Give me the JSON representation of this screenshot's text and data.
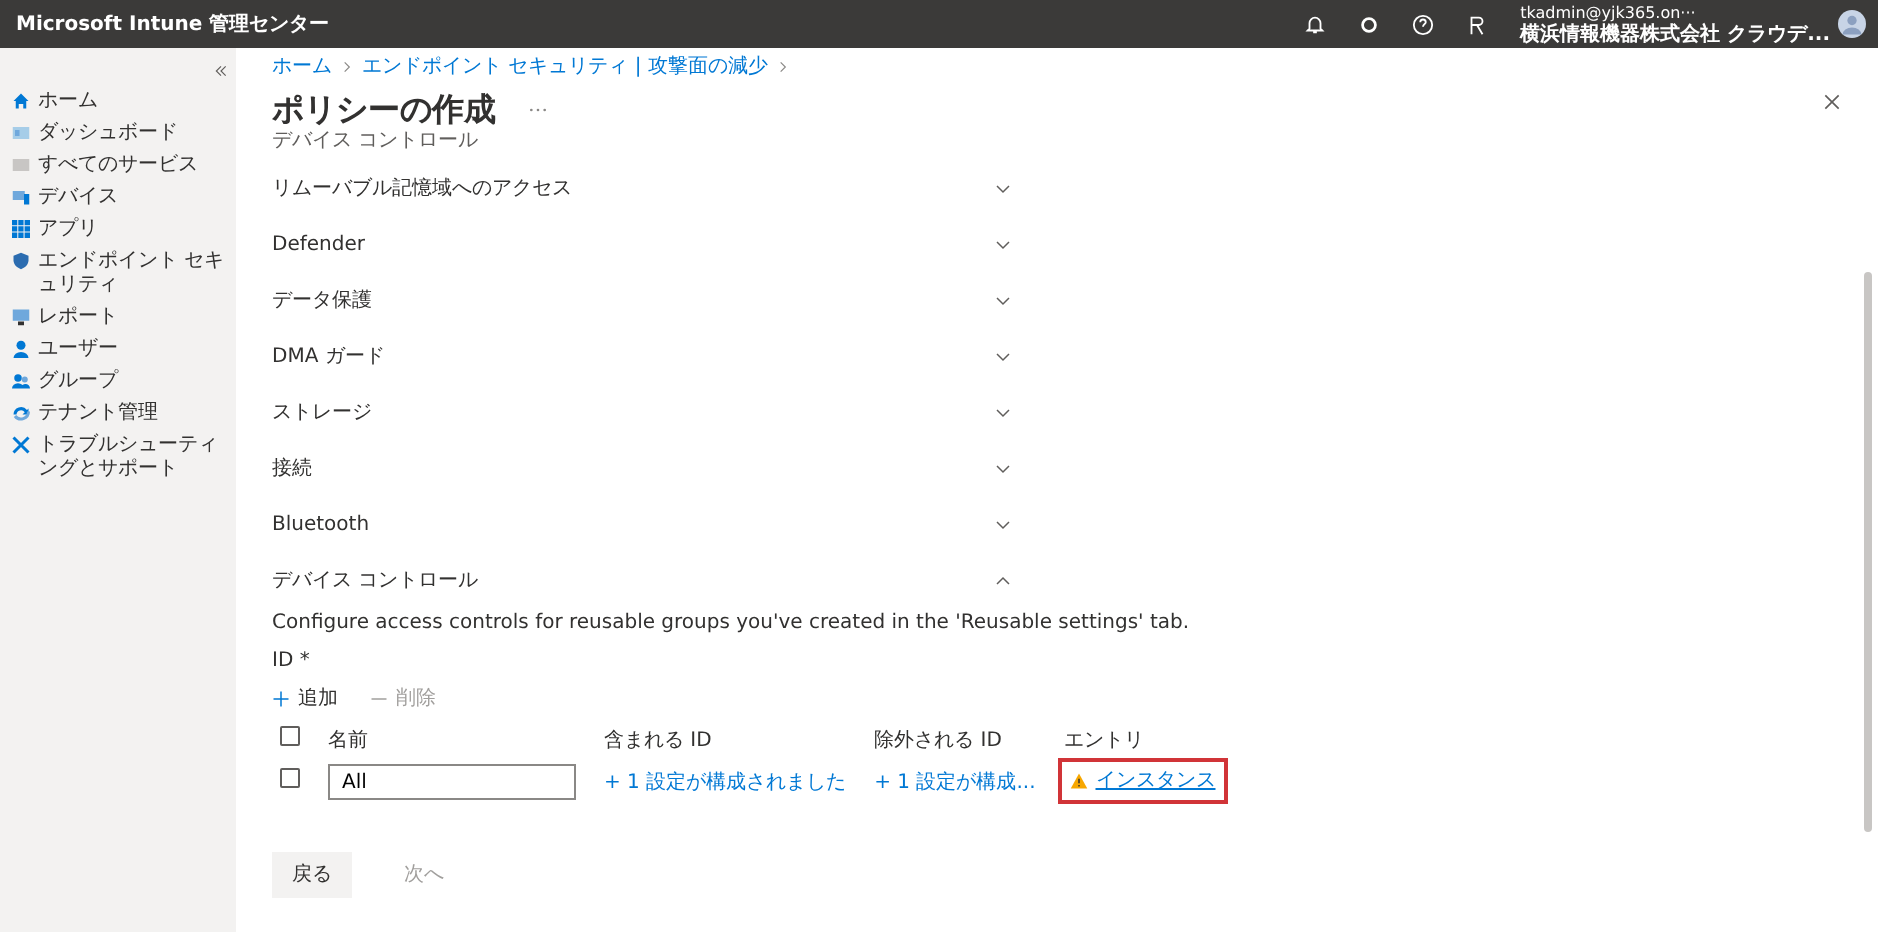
{
  "top_bar": {
    "title": "Microsoft Intune 管理センター",
    "user_email": "tkadmin@yjk365.on···",
    "user_org": "横浜情報機器株式会社 クラウデ..."
  },
  "sidebar": {
    "items": [
      {
        "label": "ホーム"
      },
      {
        "label": "ダッシュボード"
      },
      {
        "label": "すべてのサービス"
      },
      {
        "label": "デバイス"
      },
      {
        "label": "アプリ"
      },
      {
        "label": "エンドポイント セキュリティ"
      },
      {
        "label": "レポート"
      },
      {
        "label": "ユーザー"
      },
      {
        "label": "グループ"
      },
      {
        "label": "テナント管理"
      },
      {
        "label": "トラブルシューティングとサポート"
      }
    ]
  },
  "breadcrumb": [
    "ホーム",
    "エンドポイント セキュリティ | 攻撃面の減少"
  ],
  "page": {
    "title": "ポリシーの作成",
    "subtitle": "デバイス コントロール"
  },
  "sections": [
    {
      "title": "リムーバブル記憶域へのアクセス",
      "expanded": false
    },
    {
      "title": "Defender",
      "expanded": false
    },
    {
      "title": "データ保護",
      "expanded": false
    },
    {
      "title": "DMA ガード",
      "expanded": false
    },
    {
      "title": "ストレージ",
      "expanded": false
    },
    {
      "title": "接続",
      "expanded": false
    },
    {
      "title": "Bluetooth",
      "expanded": false
    },
    {
      "title": "デバイス コントロール",
      "expanded": true
    }
  ],
  "device_control": {
    "description": "Configure access controls for reusable groups you've created in the 'Reusable settings' tab.",
    "field_label": "ID *",
    "toolbar": [
      {
        "label": "追加",
        "disabled": false
      },
      {
        "label": "削除",
        "disabled": true
      }
    ],
    "table": {
      "columns": [
        "名前",
        "含まれる ID",
        "除外される ID",
        "エントリ"
      ],
      "header_checked": false,
      "rows": [
        {
          "checked": false,
          "name": "All",
          "included": "+ 1 設定が構成されました",
          "excluded": "+ 1 設定が構成...",
          "entry": "インスタンス",
          "warning": true,
          "highlighted": true
        }
      ]
    }
  },
  "footer_buttons": [
    {
      "label": "戻る",
      "disabled": false
    },
    {
      "label": "次へ",
      "disabled": true
    }
  ]
}
